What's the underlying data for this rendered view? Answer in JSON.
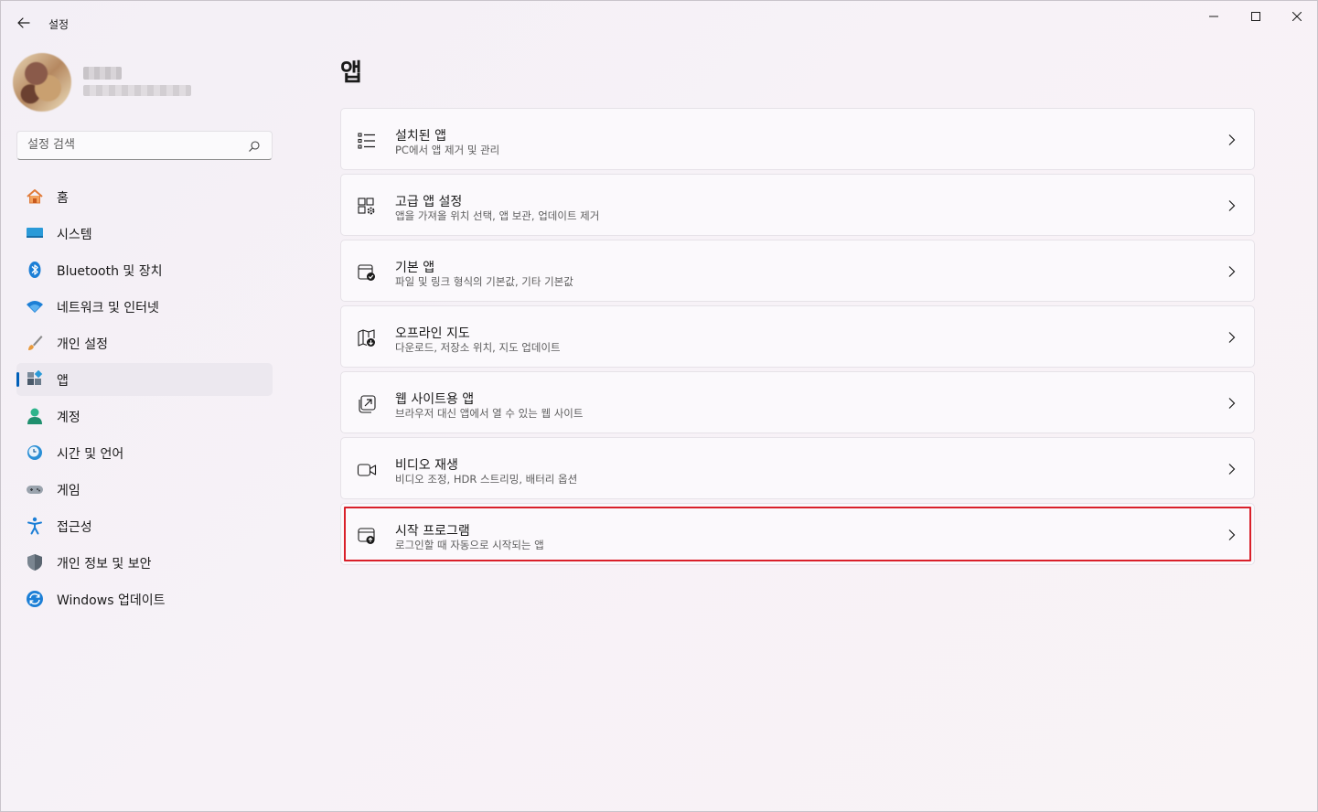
{
  "window": {
    "title": "설정",
    "controls": [
      "minimize",
      "maximize",
      "close"
    ]
  },
  "search": {
    "placeholder": "설정 검색"
  },
  "nav": [
    {
      "label": "홈",
      "icon": "home-icon"
    },
    {
      "label": "시스템",
      "icon": "system-icon"
    },
    {
      "label": "Bluetooth 및 장치",
      "icon": "bluetooth-icon"
    },
    {
      "label": "네트워크 및 인터넷",
      "icon": "wifi-icon"
    },
    {
      "label": "개인 설정",
      "icon": "brush-icon"
    },
    {
      "label": "앱",
      "icon": "apps-icon",
      "selected": true
    },
    {
      "label": "계정",
      "icon": "account-icon"
    },
    {
      "label": "시간 및 언어",
      "icon": "time-language-icon"
    },
    {
      "label": "게임",
      "icon": "gamepad-icon"
    },
    {
      "label": "접근성",
      "icon": "accessibility-icon"
    },
    {
      "label": "개인 정보 및 보안",
      "icon": "shield-icon"
    },
    {
      "label": "Windows 업데이트",
      "icon": "update-icon"
    }
  ],
  "page": {
    "title": "앱"
  },
  "cards": [
    {
      "title": "설치된 앱",
      "desc": "PC에서 앱 제거 및 관리",
      "icon": "list-icon"
    },
    {
      "title": "고급 앱 설정",
      "desc": "앱을 가져올 위치 선택, 앱 보관, 업데이트 제거",
      "icon": "advanced-apps-icon"
    },
    {
      "title": "기본 앱",
      "desc": "파일 및 링크 형식의 기본값, 기타 기본값",
      "icon": "default-apps-icon"
    },
    {
      "title": "오프라인 지도",
      "desc": "다운로드, 저장소 위치, 지도 업데이트",
      "icon": "map-icon"
    },
    {
      "title": "웹 사이트용 앱",
      "desc": "브라우저 대신 앱에서 열 수 있는 웹 사이트",
      "icon": "open-external-icon"
    },
    {
      "title": "비디오 재생",
      "desc": "비디오 조정, HDR 스트리밍, 배터리 옵션",
      "icon": "video-icon"
    },
    {
      "title": "시작 프로그램",
      "desc": "로그인할 때 자동으로 시작되는 앱",
      "icon": "startup-icon",
      "highlighted": true
    }
  ],
  "colors": {
    "accent": "#005fb8",
    "highlight": "#d9202a"
  }
}
